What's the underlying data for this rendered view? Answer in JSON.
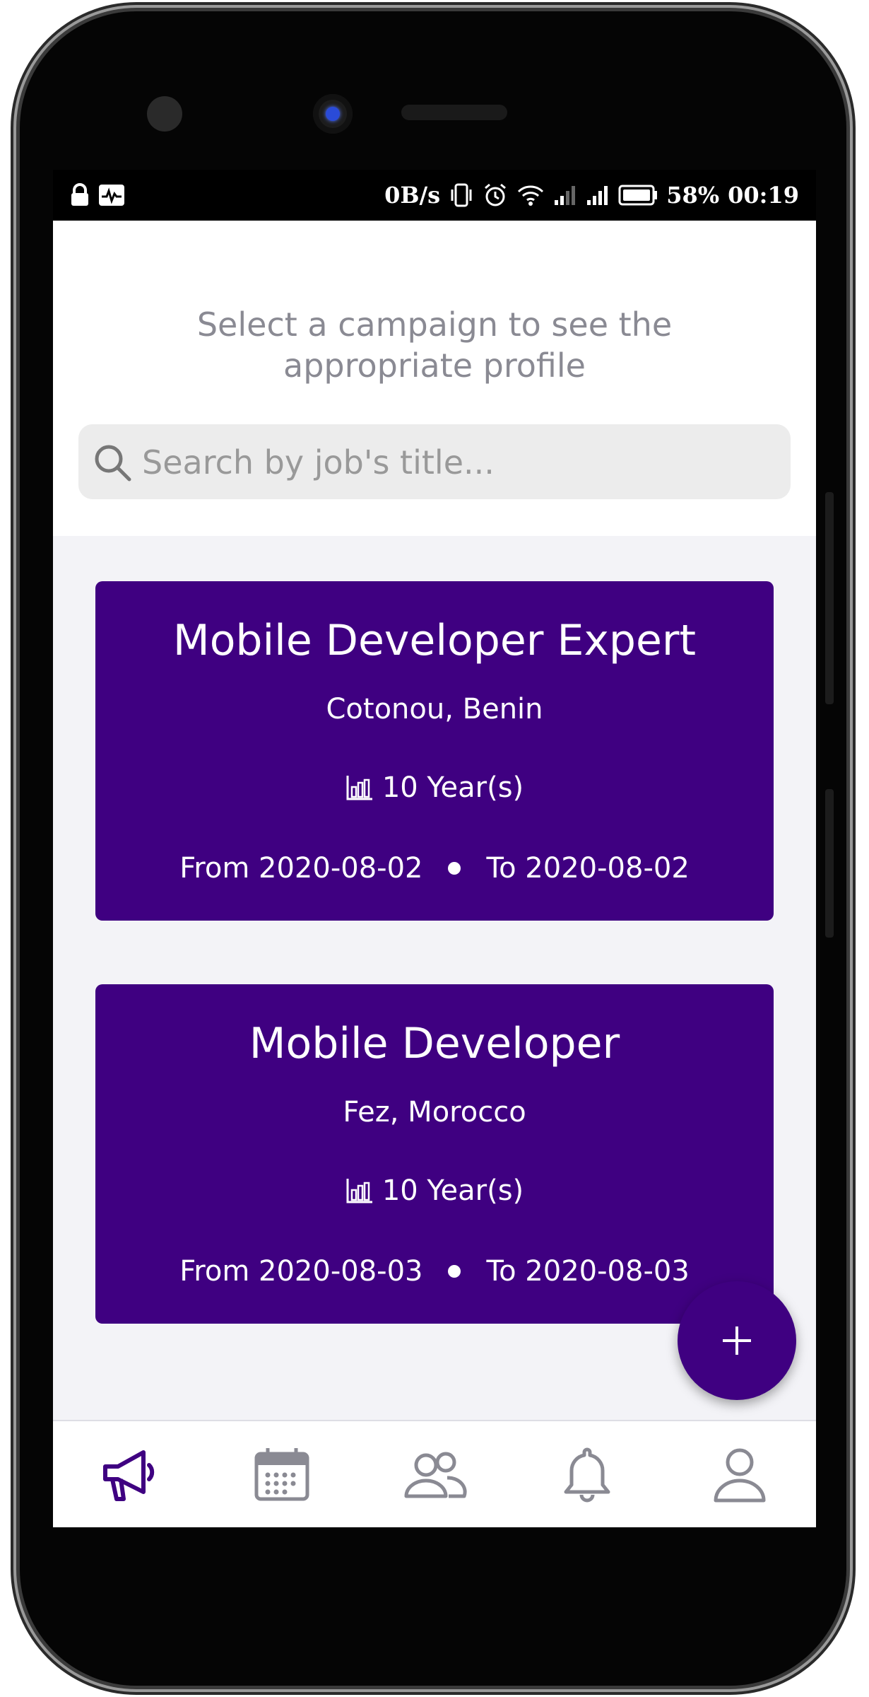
{
  "status_bar": {
    "speed": "0B/s",
    "battery_percent": "58%",
    "time": "00:19"
  },
  "header": {
    "subtitle": "Select a campaign to see the appropriate profile",
    "search": {
      "placeholder": "Search by job's title...",
      "value": ""
    }
  },
  "campaigns": [
    {
      "title": "Mobile Developer Expert",
      "location": "Cotonou, Benin",
      "experience": "10 Year(s)",
      "from": "From 2020-08-02",
      "to": "To 2020-08-02"
    },
    {
      "title": "Mobile Developer",
      "location": "Fez, Morocco",
      "experience": "10 Year(s)",
      "from": "From 2020-08-03",
      "to": "To 2020-08-03"
    }
  ],
  "nav": {
    "items": [
      {
        "icon": "megaphone-icon",
        "active": true
      },
      {
        "icon": "calendar-icon",
        "active": false
      },
      {
        "icon": "users-icon",
        "active": false
      },
      {
        "icon": "bell-icon",
        "active": false
      },
      {
        "icon": "user-icon",
        "active": false
      }
    ]
  },
  "colors": {
    "accent": "#3f0081",
    "inactive_icon": "#8a8a93",
    "background": "#f3f3f7"
  }
}
